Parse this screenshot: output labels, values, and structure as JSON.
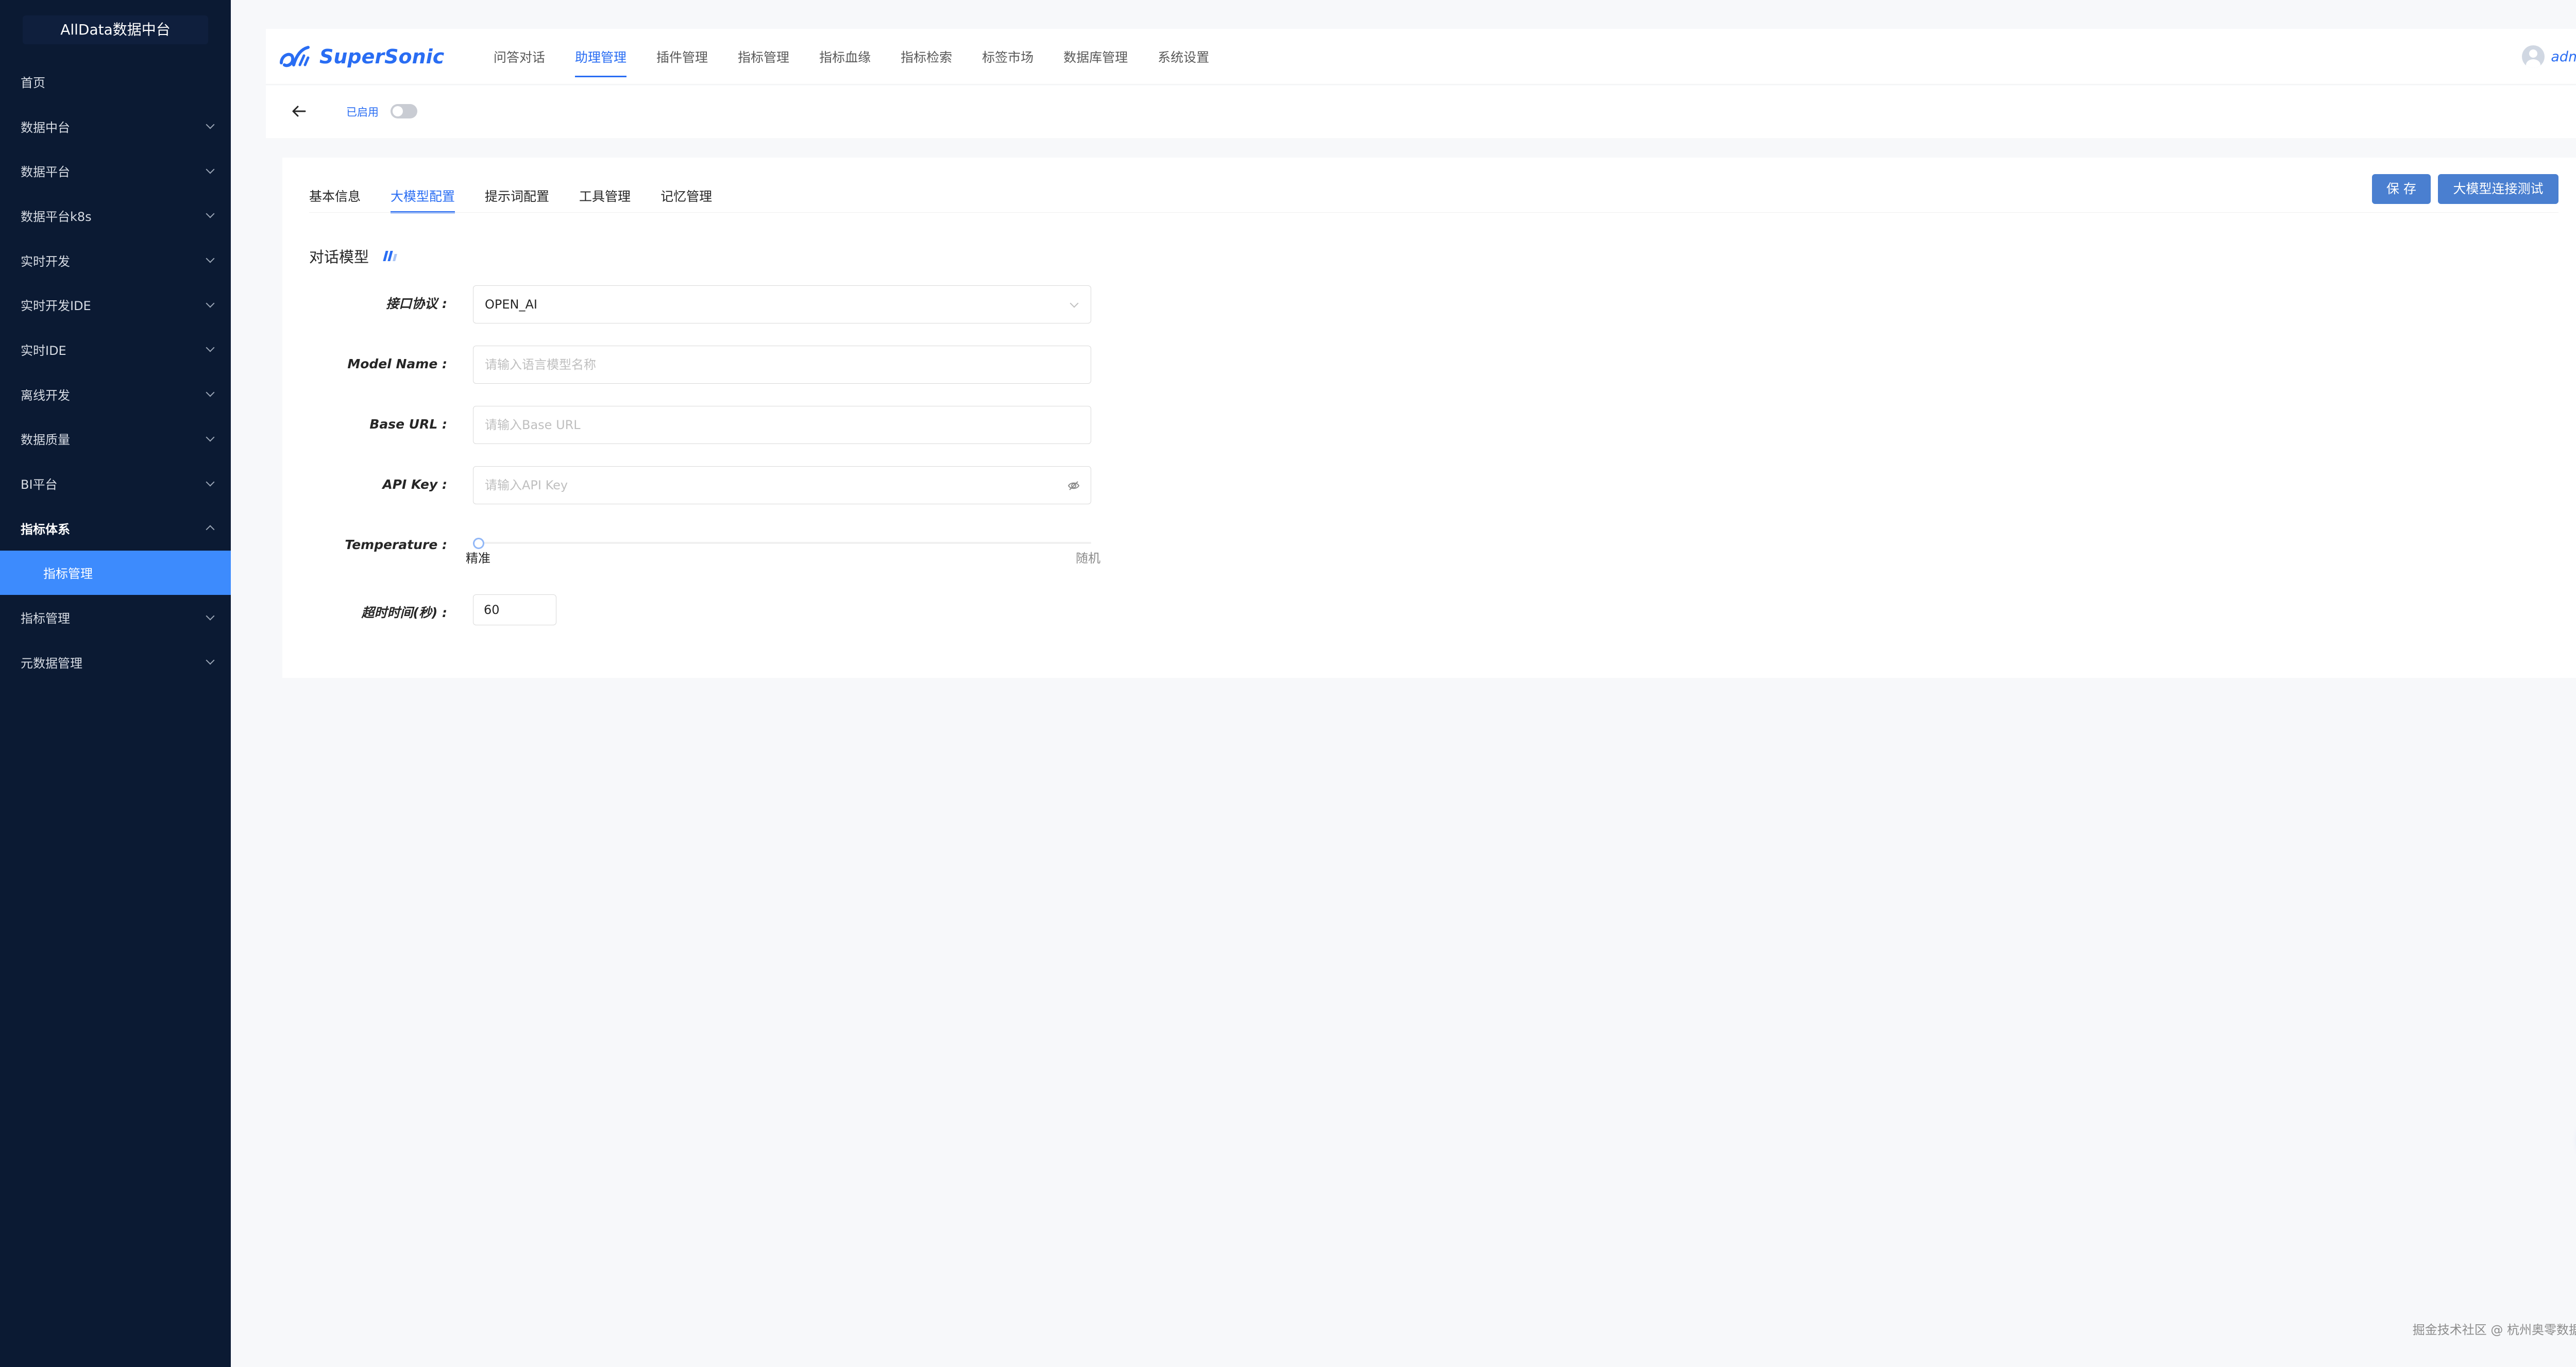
{
  "sidebar": {
    "title": "AllData数据中台",
    "items": [
      {
        "label": "首页"
      },
      {
        "label": "数据中台"
      },
      {
        "label": "数据平台"
      },
      {
        "label": "数据平台k8s"
      },
      {
        "label": "实时开发"
      },
      {
        "label": "实时开发IDE"
      },
      {
        "label": "实时IDE"
      },
      {
        "label": "离线开发"
      },
      {
        "label": "数据质量"
      },
      {
        "label": "BI平台"
      },
      {
        "label": "指标体系"
      },
      {
        "label": "指标管理"
      },
      {
        "label": "指标管理"
      },
      {
        "label": "元数据管理"
      }
    ]
  },
  "header": {
    "logo_text": "SuperSonic",
    "nav": [
      "问答对话",
      "助理管理",
      "插件管理",
      "指标管理",
      "指标血缘",
      "指标检索",
      "标签市场",
      "数据库管理",
      "系统设置"
    ],
    "active_nav": "助理管理",
    "user": "admin"
  },
  "subbar": {
    "enabled_label": "已启用",
    "enabled": false
  },
  "tabs": [
    "基本信息",
    "大模型配置",
    "提示词配置",
    "工具管理",
    "记忆管理"
  ],
  "active_tab": "大模型配置",
  "actions": {
    "save": "保 存",
    "test": "大模型连接测试"
  },
  "section_title": "对话模型",
  "form": {
    "protocol": {
      "label": "接口协议",
      "value": "OPEN_AI"
    },
    "model_name": {
      "label": "Model Name",
      "placeholder": "请输入语言模型名称"
    },
    "base_url": {
      "label": "Base URL",
      "placeholder": "请输入Base URL"
    },
    "api_key": {
      "label": "API Key",
      "placeholder": "请输入API Key"
    },
    "temperature": {
      "label": "Temperature",
      "min_label": "精准",
      "max_label": "随机",
      "value": 0
    },
    "timeout": {
      "label": "超时时间(秒)",
      "value": "60"
    }
  },
  "footer": "掘金技术社区 @ 杭州奥零数据科技",
  "colors": {
    "primary": "#296df3",
    "sidebar_bg": "#0b1a33",
    "sidebar_active": "#3d8bfd",
    "button": "#4a7fd0"
  }
}
